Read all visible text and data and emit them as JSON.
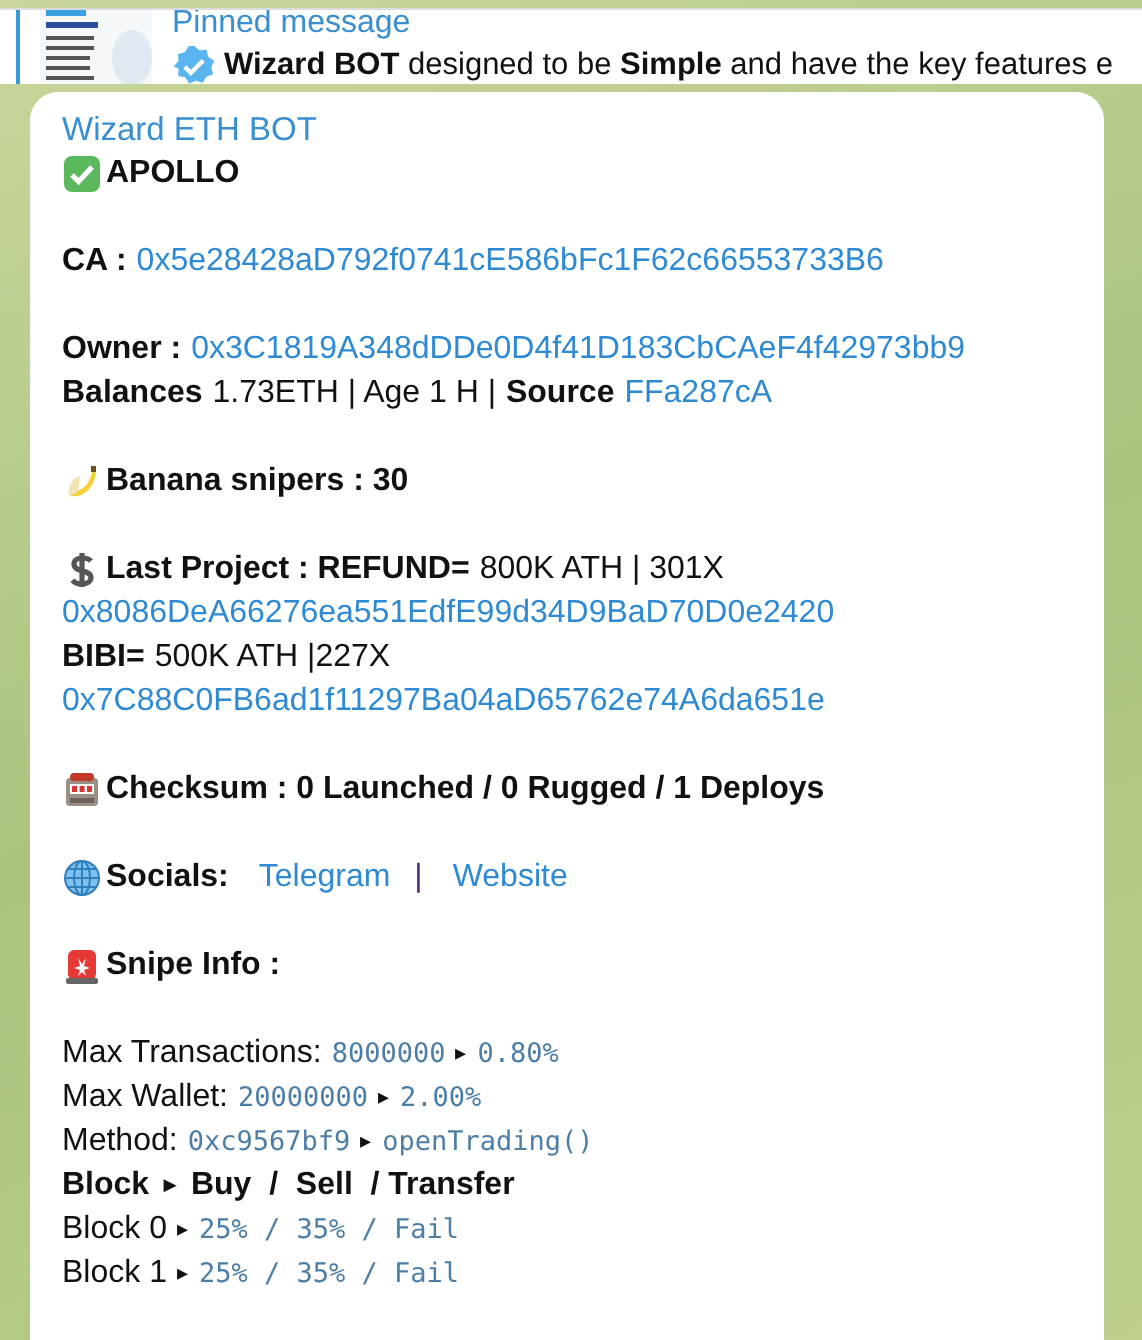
{
  "pinned": {
    "title": "Pinned message",
    "text": "**Wizard BOT** designed to be **Simple** and have the key features e"
  },
  "message": {
    "sender": "Wizard ETH BOT",
    "sections": [
      {
        "kind": "status",
        "lines": [
          [
            {
              "text": "APOLLO",
              "kind": "bold"
            }
          ]
        ]
      },
      {
        "kind": "plain",
        "lines": [
          [
            {
              "text": "CA :",
              "kind": "bold"
            },
            {
              "text": "0x5e28428aD792f0741cE586bFc1F62c66553733B6",
              "kind": "link"
            }
          ]
        ]
      },
      {
        "kind": "plain",
        "lines": [
          [
            {
              "text": "Owner :",
              "kind": "bold"
            },
            {
              "text": "0x3C1819A348dDDe0D4f41D183CbCAeF4f42973bb9",
              "kind": "link"
            }
          ],
          [
            {
              "text": "Balances",
              "kind": "bold"
            },
            {
              "text": "1.73ETH | Age 1 H |",
              "kind": "plain"
            },
            {
              "text": "Source",
              "kind": "bold"
            },
            {
              "text": "FFa287cA",
              "kind": "link"
            }
          ]
        ]
      },
      {
        "kind": "snipers",
        "lines": [
          [
            {
              "text": "Banana snipers : 30",
              "kind": "bold"
            }
          ]
        ]
      },
      {
        "kind": "project",
        "lines": [
          [
            {
              "text": "Last Project : REFUND=",
              "kind": "bold"
            },
            {
              "text": "800K ATH | 301X",
              "kind": "plain"
            }
          ],
          [
            {
              "text": "0x8086DeA66276ea551EdfE99d34D9BaD70D0e2420",
              "kind": "link"
            }
          ],
          [
            {
              "text": "BIBI=",
              "kind": "bold"
            },
            {
              "text": "500K ATH |227X",
              "kind": "plain"
            }
          ],
          [
            {
              "text": "0x7C88C0FB6ad1f11297Ba04aD65762e74A6da651e",
              "kind": "link"
            }
          ]
        ]
      },
      {
        "kind": "checksum",
        "lines": [
          [
            {
              "text": "Checksum : 0 Launched / 0 Rugged / 1 Deploys",
              "kind": "bold"
            }
          ]
        ]
      },
      {
        "kind": "socials",
        "lines": [
          [
            {
              "text": "Socials:",
              "kind": "bold"
            },
            {
              "text": "Telegram",
              "kind": "social"
            },
            {
              "text": "|",
              "kind": "sep"
            },
            {
              "text": "Website",
              "kind": "social"
            }
          ]
        ]
      },
      {
        "kind": "snipe",
        "lines": [
          [
            {
              "text": "Snipe Info :",
              "kind": "bold"
            }
          ]
        ]
      },
      {
        "kind": "plain",
        "lines": [
          [
            {
              "text": "Max Transactions:",
              "kind": "plain"
            },
            {
              "text": "8000000",
              "kind": "mono"
            },
            {
              "text": "▸",
              "kind": "arrow"
            },
            {
              "text": "0.80%",
              "kind": "mono"
            }
          ],
          [
            {
              "text": "Max Wallet:",
              "kind": "plain"
            },
            {
              "text": "20000000",
              "kind": "mono"
            },
            {
              "text": "▸",
              "kind": "arrow"
            },
            {
              "text": "2.00%",
              "kind": "mono"
            }
          ],
          [
            {
              "text": "Method:",
              "kind": "plain"
            },
            {
              "text": "0xc9567bf9",
              "kind": "mono"
            },
            {
              "text": "▸",
              "kind": "arrow"
            },
            {
              "text": "openTrading()",
              "kind": "mono"
            }
          ],
          [
            {
              "text": "Block",
              "kind": "bold"
            },
            {
              "text": "►",
              "kind": "arrow"
            },
            {
              "text": "Buy  /  Sell  / Transfer",
              "kind": "bold"
            }
          ],
          [
            {
              "text": "Block 0",
              "kind": "plain"
            },
            {
              "text": "▸",
              "kind": "arrow"
            },
            {
              "text": "25% / 35% / Fail",
              "kind": "mono"
            }
          ],
          [
            {
              "text": "Block 1",
              "kind": "plain"
            },
            {
              "text": "▸",
              "kind": "arrow"
            },
            {
              "text": "25% / 35% / Fail",
              "kind": "mono"
            }
          ]
        ]
      }
    ]
  }
}
